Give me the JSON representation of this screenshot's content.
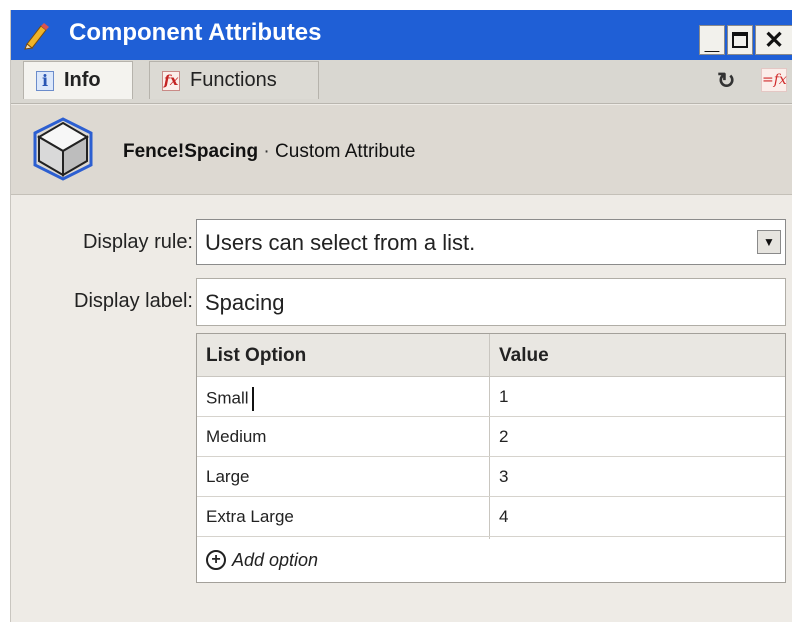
{
  "window": {
    "title": "Component Attributes",
    "minimize_glyph": "_",
    "close_glyph": "✕",
    "accent_color": "#1f5fd6"
  },
  "tabs": [
    {
      "label": "Info",
      "icon": "info-icon",
      "active": true
    },
    {
      "label": "Functions",
      "icon": "function-icon",
      "active": false
    }
  ],
  "toolbar": {
    "refresh_glyph": "↻",
    "formula_glyph": "=fx"
  },
  "header": {
    "component_name": "Fence!Spacing",
    "separator": " · ",
    "attribute_type": "Custom Attribute"
  },
  "form": {
    "display_rule_label": "Display rule:",
    "display_rule_value": "Users can select from a list.",
    "display_label_label": "Display label:",
    "display_label_value": "Spacing"
  },
  "options_table": {
    "columns": [
      "List Option",
      "Value"
    ],
    "rows": [
      {
        "option": "Small",
        "value": "1"
      },
      {
        "option": "Medium",
        "value": "2"
      },
      {
        "option": "Large",
        "value": "3"
      },
      {
        "option": "Extra Large",
        "value": "4"
      }
    ],
    "add_label": "Add option"
  }
}
